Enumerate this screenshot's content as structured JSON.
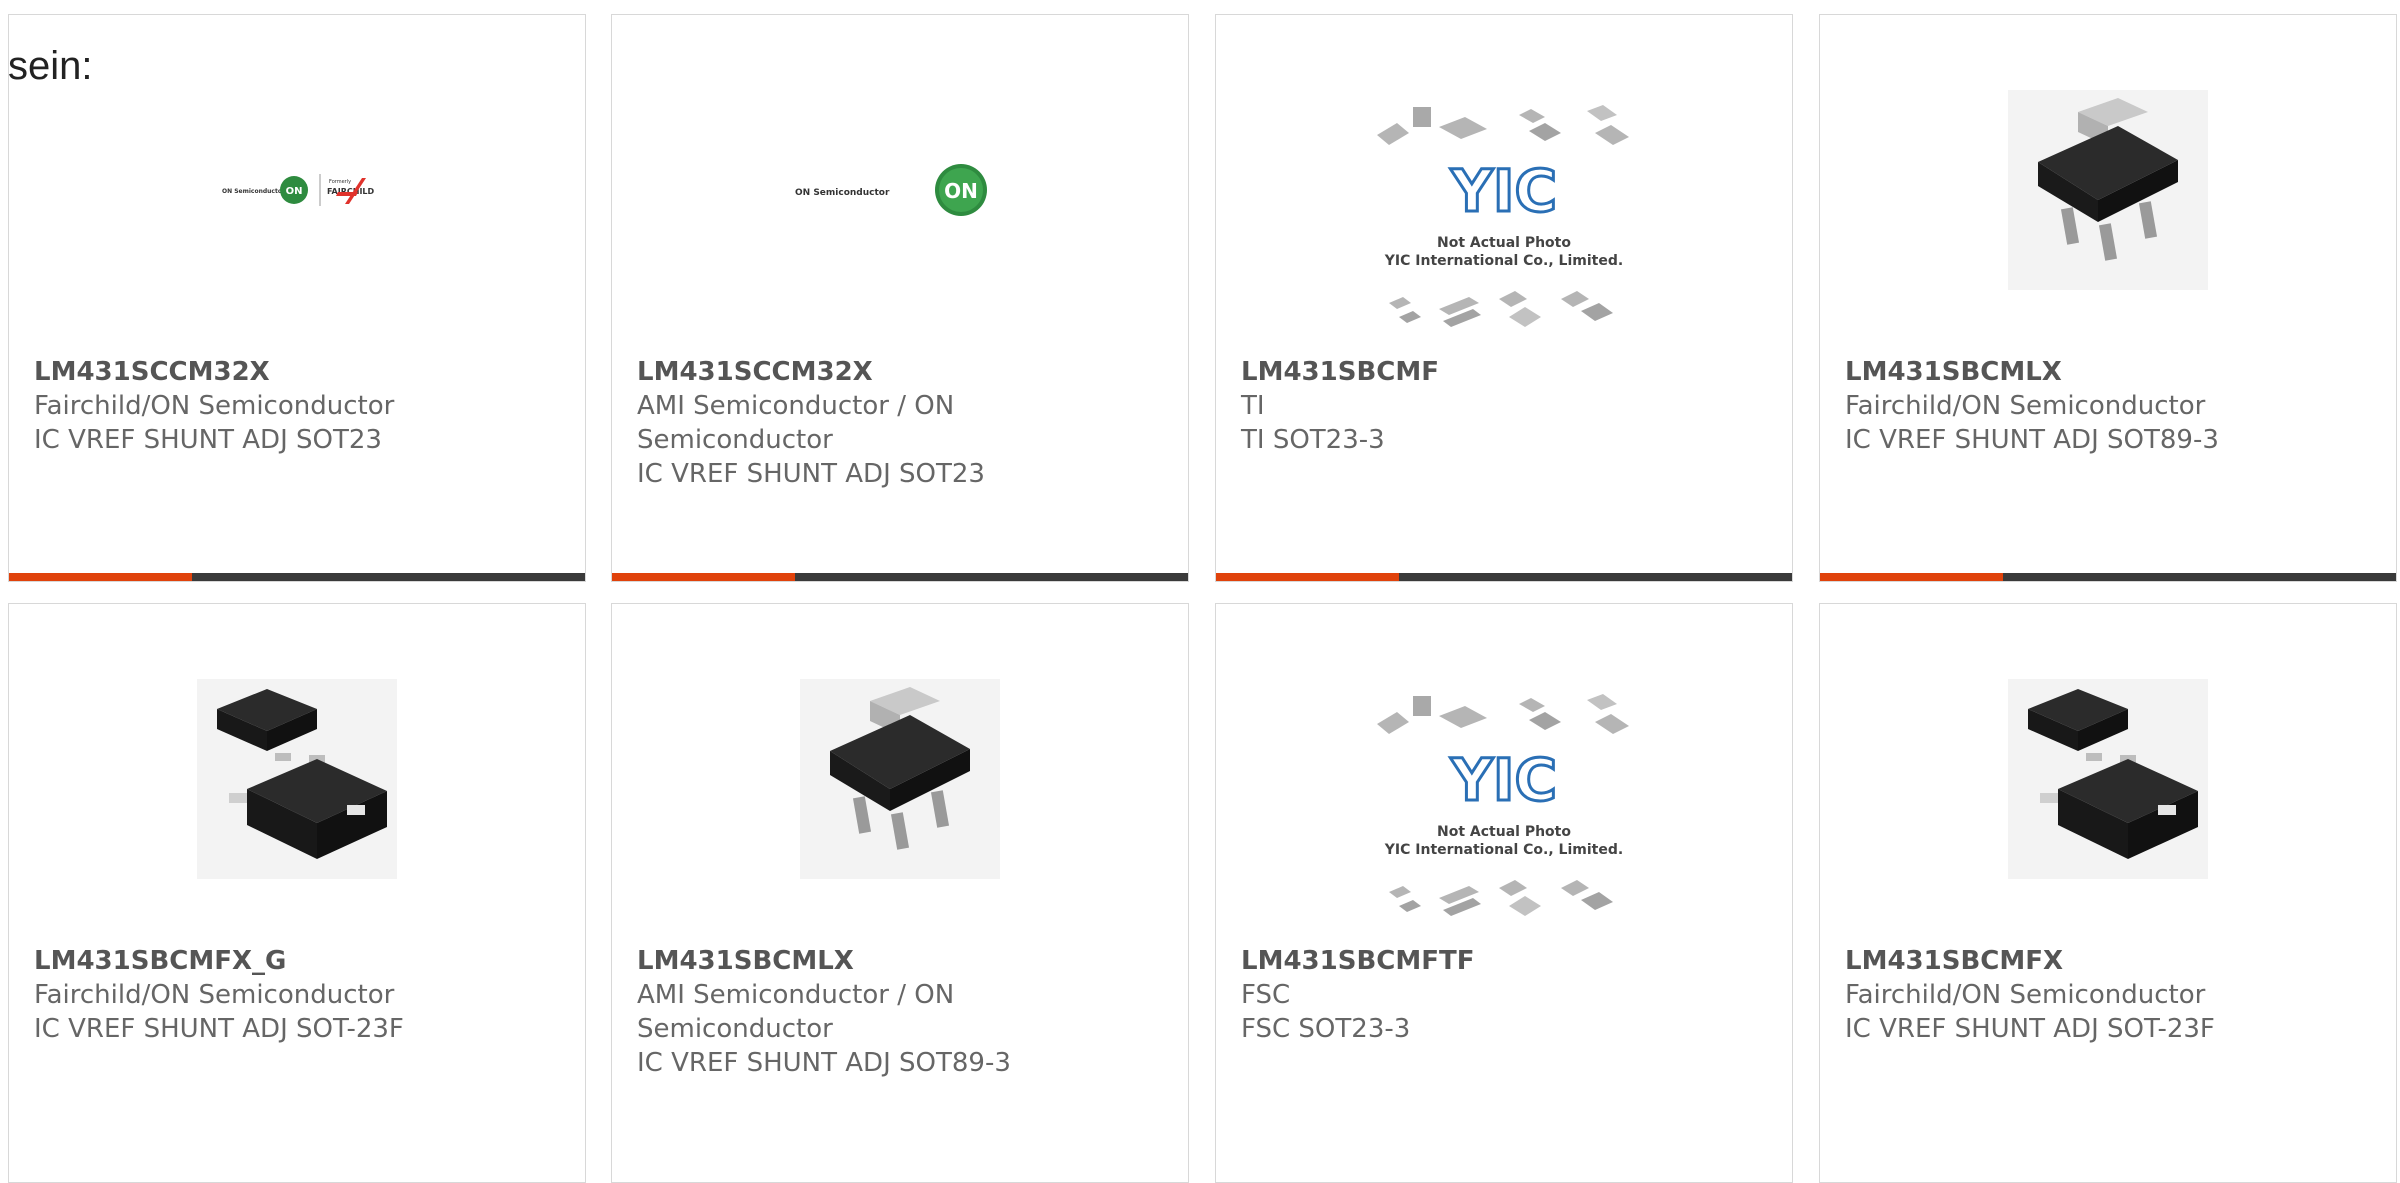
{
  "heading": "sein:",
  "colors": {
    "accent": "#e0420b",
    "bar": "#3a3a3a"
  },
  "cards": [
    {
      "part": "LM431SCCM32X",
      "maker": "Fairchild/ON Semiconductor",
      "desc": "IC VREF SHUNT ADJ SOT23",
      "image": "on-semi-fairchild-logo"
    },
    {
      "part": "LM431SCCM32X",
      "maker": "AMI Semiconductor / ON Semiconductor",
      "desc": "IC VREF SHUNT ADJ SOT23",
      "image": "on-semiconductor-logo"
    },
    {
      "part": "LM431SBCMF",
      "maker": "TI",
      "desc": "TI SOT23-3",
      "image": "not-actual-photo-placeholder"
    },
    {
      "part": "LM431SBCMLX",
      "maker": "Fairchild/ON Semiconductor",
      "desc": "IC VREF SHUNT ADJ SOT89-3",
      "image": "sot89-package"
    },
    {
      "part": "LM431SBCMFX_G",
      "maker": "Fairchild/ON Semiconductor",
      "desc": "IC VREF SHUNT ADJ SOT-23F",
      "image": "sot23f-package"
    },
    {
      "part": "LM431SBCMLX",
      "maker": "AMI Semiconductor / ON Semiconductor",
      "desc": "IC VREF SHUNT ADJ SOT89-3",
      "image": "sot89-package"
    },
    {
      "part": "LM431SBCMFTF",
      "maker": "FSC",
      "desc": "FSC SOT23-3",
      "image": "not-actual-photo-placeholder"
    },
    {
      "part": "LM431SBCMFX",
      "maker": "Fairchild/ON Semiconductor",
      "desc": "IC VREF SHUNT ADJ SOT-23F",
      "image": "sot23f-package"
    }
  ],
  "logos": {
    "on_semi_small": "ON Semiconductor",
    "formerly": "Formerly",
    "fairchild": "FAIRCHILD",
    "on_semi_large": "ON Semiconductor",
    "on_mark": "ON"
  },
  "placeholder": {
    "brand": "YIC",
    "line1": "Not Actual Photo",
    "line2": "YIC International Co., Limited."
  }
}
